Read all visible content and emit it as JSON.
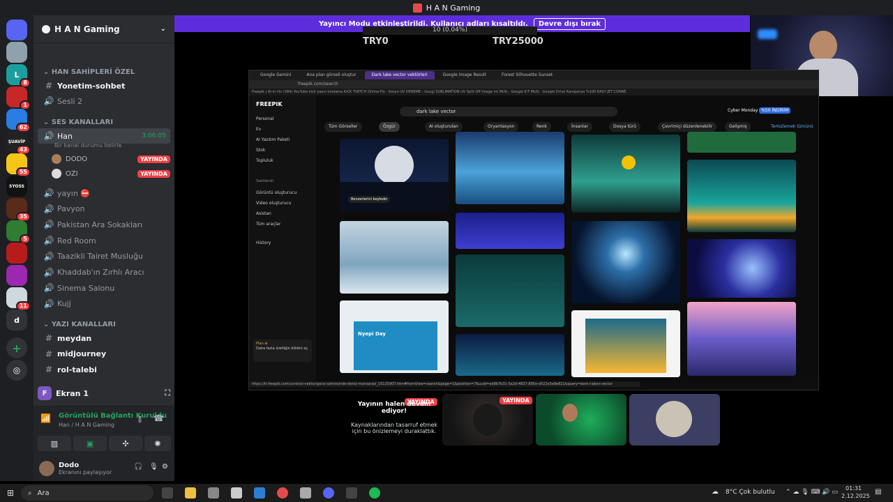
{
  "window": {
    "title": "H A N Gaming"
  },
  "guilds": [
    {
      "label": "",
      "badge": "",
      "color": "#5865f2"
    },
    {
      "label": "",
      "badge": "",
      "color": "#8ea1ad"
    },
    {
      "label": "L",
      "badge": "8",
      "color": "#1d9e9e"
    },
    {
      "label": "",
      "badge": "1",
      "color": "#c62828"
    },
    {
      "label": "",
      "badge": "62",
      "color": "#2a7de1"
    },
    {
      "label": "ŞUAVİP",
      "badge": "43",
      "color": "#222222"
    },
    {
      "label": "",
      "badge": "55",
      "color": "#f5c518"
    },
    {
      "label": "SYOSS",
      "badge": "",
      "color": "#111111"
    },
    {
      "label": "",
      "badge": "35",
      "color": "#5b2b1a"
    },
    {
      "label": "",
      "badge": "5",
      "color": "#2e7d32"
    },
    {
      "label": "",
      "badge": "",
      "color": "#b71c1c"
    },
    {
      "label": "",
      "badge": "",
      "color": "#9c27b0"
    },
    {
      "label": "",
      "badge": "11",
      "color": "#cfd8dc"
    },
    {
      "label": "d",
      "badge": "",
      "color": "#313338"
    }
  ],
  "server": {
    "name": "H A N Gaming",
    "categories": {
      "owners": "HAN SAHİPLERİ ÖZEL",
      "voice": "SES KANALLARI",
      "text": "YAZI KANALLARI"
    },
    "owner_channels": [
      "Yonetim-sohbet",
      "Sesli 2"
    ],
    "active_voice": {
      "name": "Han",
      "timer": "3:06:05",
      "status": "Bir kanal durumu belirle"
    },
    "members": [
      {
        "name": "DODO",
        "badge": "YAYINDA"
      },
      {
        "name": "OZI",
        "badge": "YAYINDA"
      }
    ],
    "voice_channels": [
      "yayın ⛔",
      "Pavyon",
      "Pakistan Ara Sokakları",
      "Red Room",
      "Taazikli Tairet Musluğu",
      "Khaddab'ın Zırhlı Aracı",
      "Sinema Salonu",
      "Kujj"
    ],
    "text_channels": [
      "meydan",
      "midjourney",
      "rol-talebi"
    ]
  },
  "screen_share": {
    "label": "Ekran 1"
  },
  "voice_status": {
    "title": "Görüntülü Bağlantı Kuruldu",
    "subtitle": "Han / H A N Gaming"
  },
  "user": {
    "name": "Dodo",
    "status": "Ekranını paylaşıyor"
  },
  "streamer_banner": {
    "text": "Yayıncı Modu etkinleştirildi. Kullanıcı adları kısaltıldı.",
    "button": "Devre dışı bırak"
  },
  "ticker": {
    "text": "10 (0.04%)",
    "left_value": "TRY0",
    "right_value": "TRY25000"
  },
  "browser": {
    "tabs": [
      "Google Gemini",
      "Ana plan görseli oluştur",
      "Dark lake vector vektörleri",
      "Google Image Result",
      "Forest Silhouette Sunset"
    ],
    "url": "freepik.com/search",
    "bookmarks": "Freepik | AI-in-On   (384) YouTube   kick yayın kiralama   KICK   TWITCH   Online-Fix - Sosyo   UV DENEME - Googl   SUBLIMATION UV   Split Off image int   MUG - Google E-T   MUG - Google Drive   Kampanya %100   EASY JET CONNE",
    "status_url": "https://tr.freepik.com/ucretsiz-vektor/gece-sahnesinde-deniz-manzarasi_10125907.htm#fromView=search&page=1&position=7&uuid=ad9b7b31-5a2d-4837-895e-e022e3e9e821&query=dark+lake+vector"
  },
  "freepik": {
    "logo": "FREEPIK",
    "nav": [
      "Personal",
      "Ev",
      "AI Yazılım Paketi",
      "Stok",
      "Topluluk"
    ],
    "section": "Sabitlendi",
    "tools": [
      "Görüntü oluşturucu",
      "Video oluşturucu",
      "Asistan",
      "Tüm araçlar",
      "History"
    ],
    "plan": {
      "title": "Plan al",
      "text": "Daha fazla özelliğin kilidini aç"
    },
    "search": "dark lake vector",
    "promo": "Cyber Monday",
    "promo_badge": "%50 İNDİRİM",
    "filters": [
      "Tüm Görseller",
      "Özgür",
      "AI oluşturulan",
      "Oryantasyon",
      "Renk",
      "İnsanlar",
      "Dosya türü",
      "Çevrimiçi düzenlenebilir",
      "Gelişmiş",
      "Temizlemek tümünü"
    ],
    "hover_label": "Benzerlerini keşfedin",
    "card_title": "Nyepi Day"
  },
  "stream_tiles": {
    "paused": {
      "badge": "YAYINDA",
      "title": "Yayının halen devam ediyor!",
      "text": "Kaynaklarından tasarruf etmek için bu önizlemeyi duraklattık."
    },
    "tile2_badge": "YAYINDA"
  },
  "taskbar": {
    "search": "Ara",
    "weather": "8°C  Çok bulutlu",
    "time": "01:31",
    "date": "2.12.2025"
  }
}
